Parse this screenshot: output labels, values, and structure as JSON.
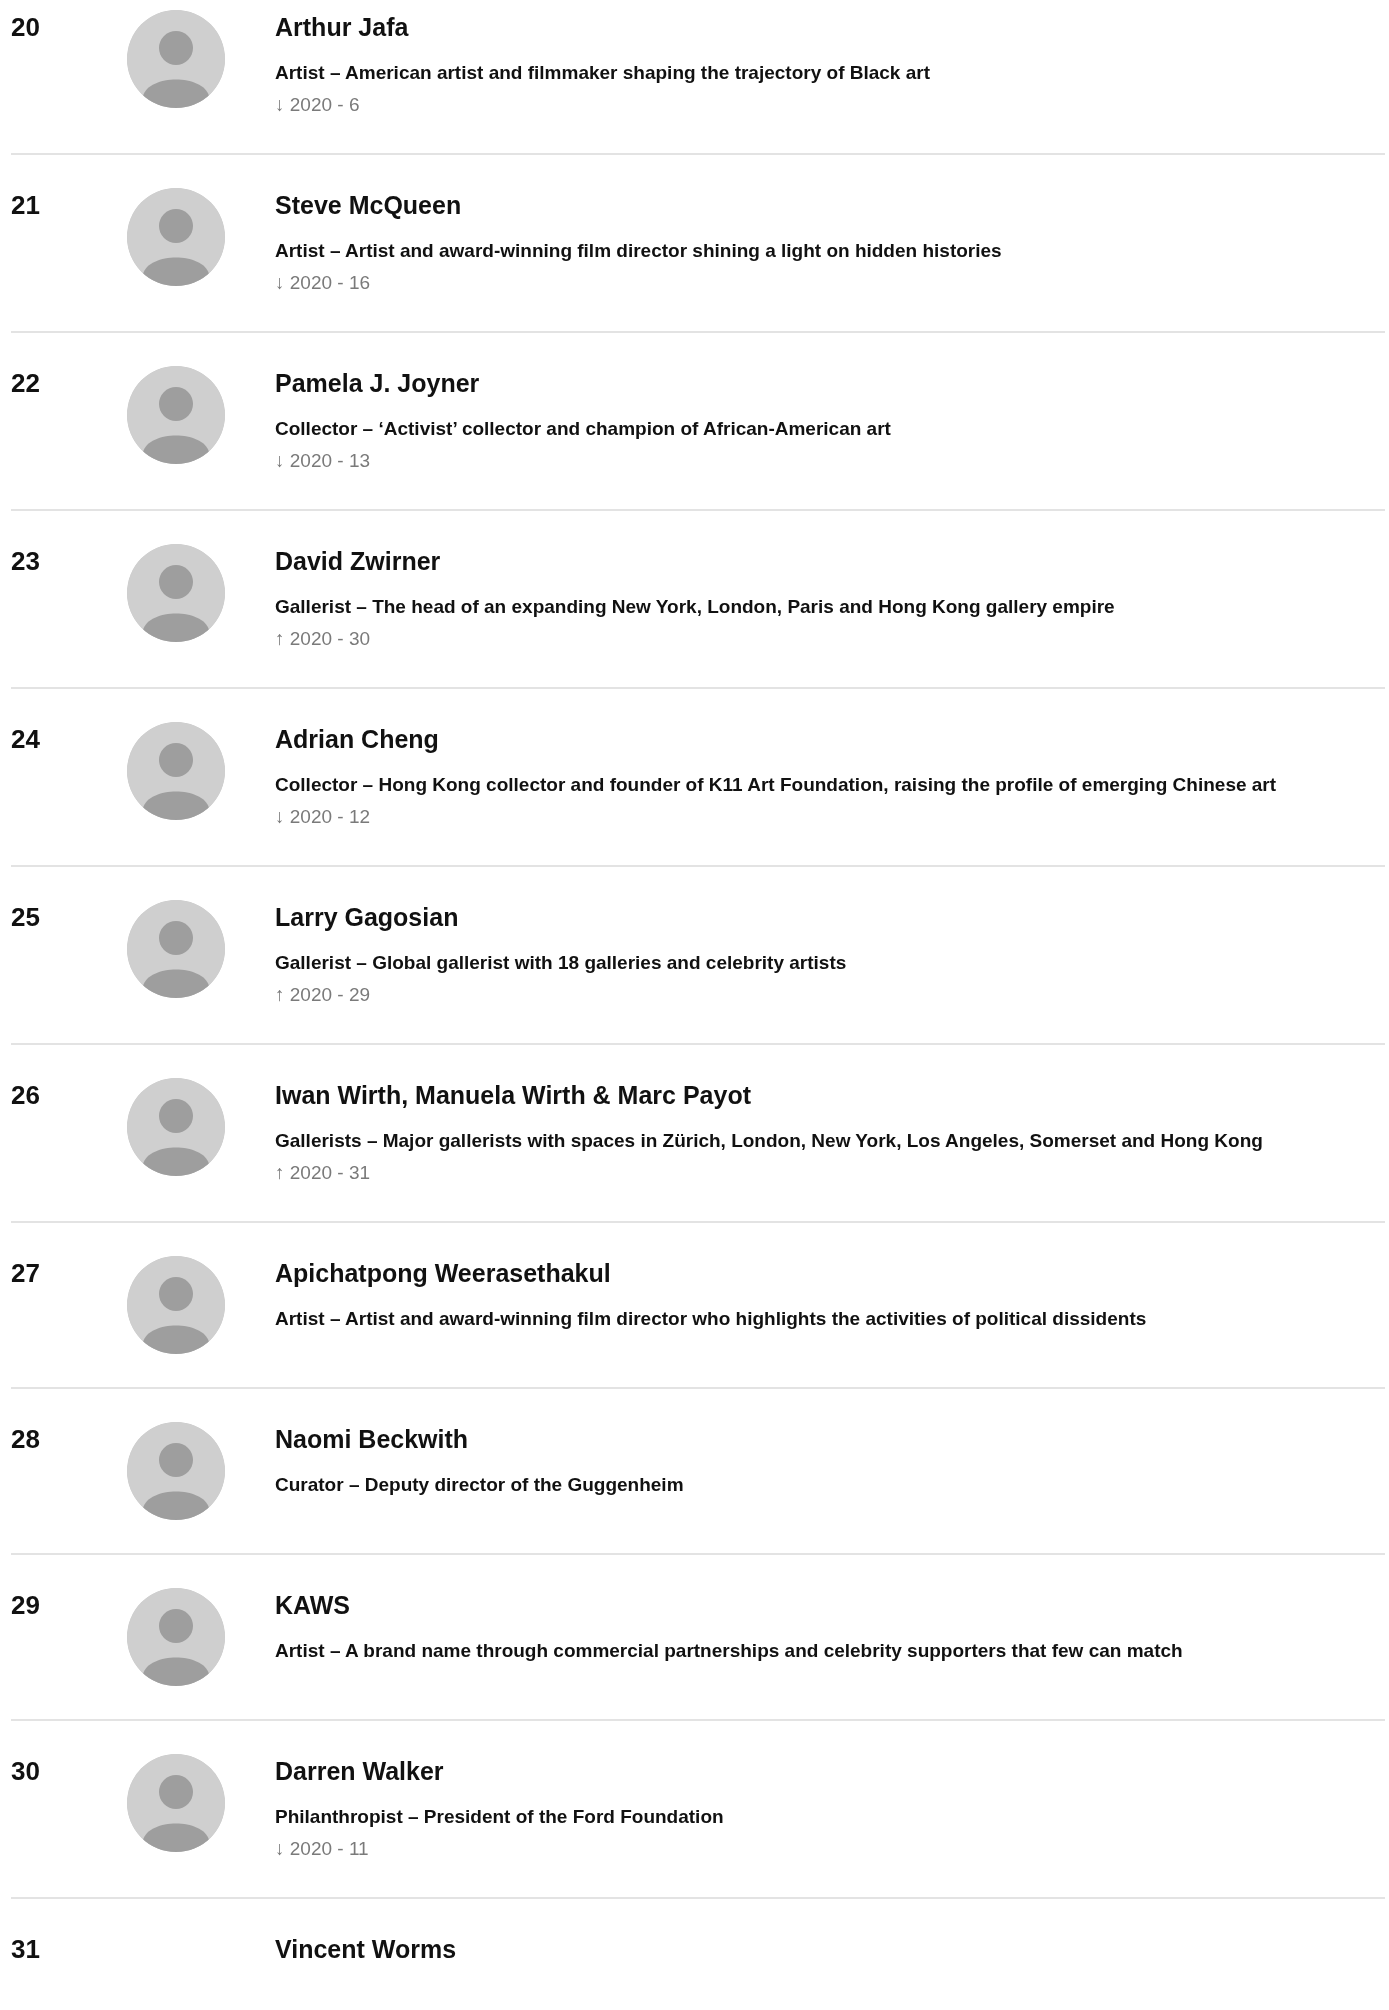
{
  "entries": [
    {
      "rank": "20",
      "name": "Arthur Jafa",
      "description": "Artist – American artist and filmmaker shaping the trajectory of Black art",
      "change": "↓ 2020 - 6",
      "photo": true
    },
    {
      "rank": "21",
      "name": "Steve McQueen",
      "description": "Artist – Artist and award-winning film director shining a light on hidden histories",
      "change": "↓ 2020 - 16",
      "photo": true
    },
    {
      "rank": "22",
      "name": "Pamela J. Joyner",
      "description": "Collector – ‘Activist’ collector and champion of African-American art",
      "change": "↓ 2020 - 13",
      "photo": true
    },
    {
      "rank": "23",
      "name": "David Zwirner",
      "description": "Gallerist – The head of an expanding New York, London, Paris and Hong Kong gallery empire",
      "change": "↑ 2020 - 30",
      "photo": true
    },
    {
      "rank": "24",
      "name": "Adrian Cheng",
      "description": "Collector – Hong Kong collector and founder of K11 Art Foundation, raising the profile of emerging Chinese art",
      "change": "↓ 2020 - 12",
      "photo": true
    },
    {
      "rank": "25",
      "name": "Larry Gagosian",
      "description": "Gallerist – Global gallerist with 18 galleries and celebrity artists",
      "change": "↑ 2020 - 29",
      "photo": true
    },
    {
      "rank": "26",
      "name": "Iwan Wirth, Manuela Wirth & Marc Payot",
      "description": "Gallerists – Major gallerists with spaces in Zürich, London, New York, Los Angeles, Somerset and Hong Kong",
      "change": "↑ 2020 - 31",
      "photo": true
    },
    {
      "rank": "27",
      "name": "Apichatpong Weerasethakul",
      "description": "Artist – Artist and award-winning film director who highlights the activities of political dissidents",
      "photo": true
    },
    {
      "rank": "28",
      "name": "Naomi Beckwith",
      "description": "Curator – Deputy director of the Guggenheim",
      "photo": true
    },
    {
      "rank": "29",
      "name": "KAWS",
      "description": "Artist – A brand name through commercial partnerships and celebrity supporters that few can match",
      "photo": true
    },
    {
      "rank": "30",
      "name": "Darren Walker",
      "description": "Philanthropist – President of the Ford Foundation",
      "change": "↓ 2020 - 11",
      "photo": true
    },
    {
      "rank": "31",
      "name": "Vincent Worms",
      "photo": false
    }
  ]
}
